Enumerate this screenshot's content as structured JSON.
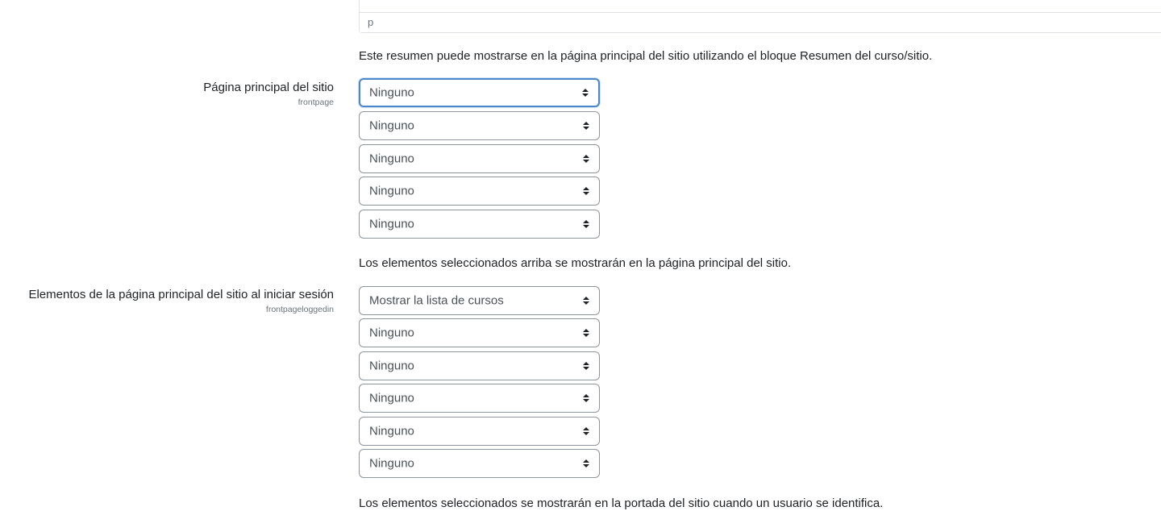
{
  "editor": {
    "path": "p"
  },
  "summary_hint": "Este resumen puede mostrarse en la página principal del sitio utilizando el bloque Resumen del curso/sitio.",
  "frontpage": {
    "label": "Página principal del sitio",
    "setting": "frontpage",
    "selects": [
      "Ninguno",
      "Ninguno",
      "Ninguno",
      "Ninguno",
      "Ninguno"
    ],
    "hint": "Los elementos seleccionados arriba se mostrarán en la página principal del sitio."
  },
  "frontpageloggedin": {
    "label": "Elementos de la página principal del sitio al iniciar sesión",
    "setting": "frontpageloggedin",
    "selects": [
      "Mostrar la lista de cursos",
      "Ninguno",
      "Ninguno",
      "Ninguno",
      "Ninguno",
      "Ninguno"
    ],
    "hint": "Los elementos seleccionados se mostrarán en la portada del sitio cuando un usuario se identifica."
  },
  "icons": {
    "select_caret": "up-down-caret-icon"
  },
  "colors": {
    "focus_border": "#4b88c9",
    "text": "#1d2125",
    "muted": "#6a737b"
  }
}
